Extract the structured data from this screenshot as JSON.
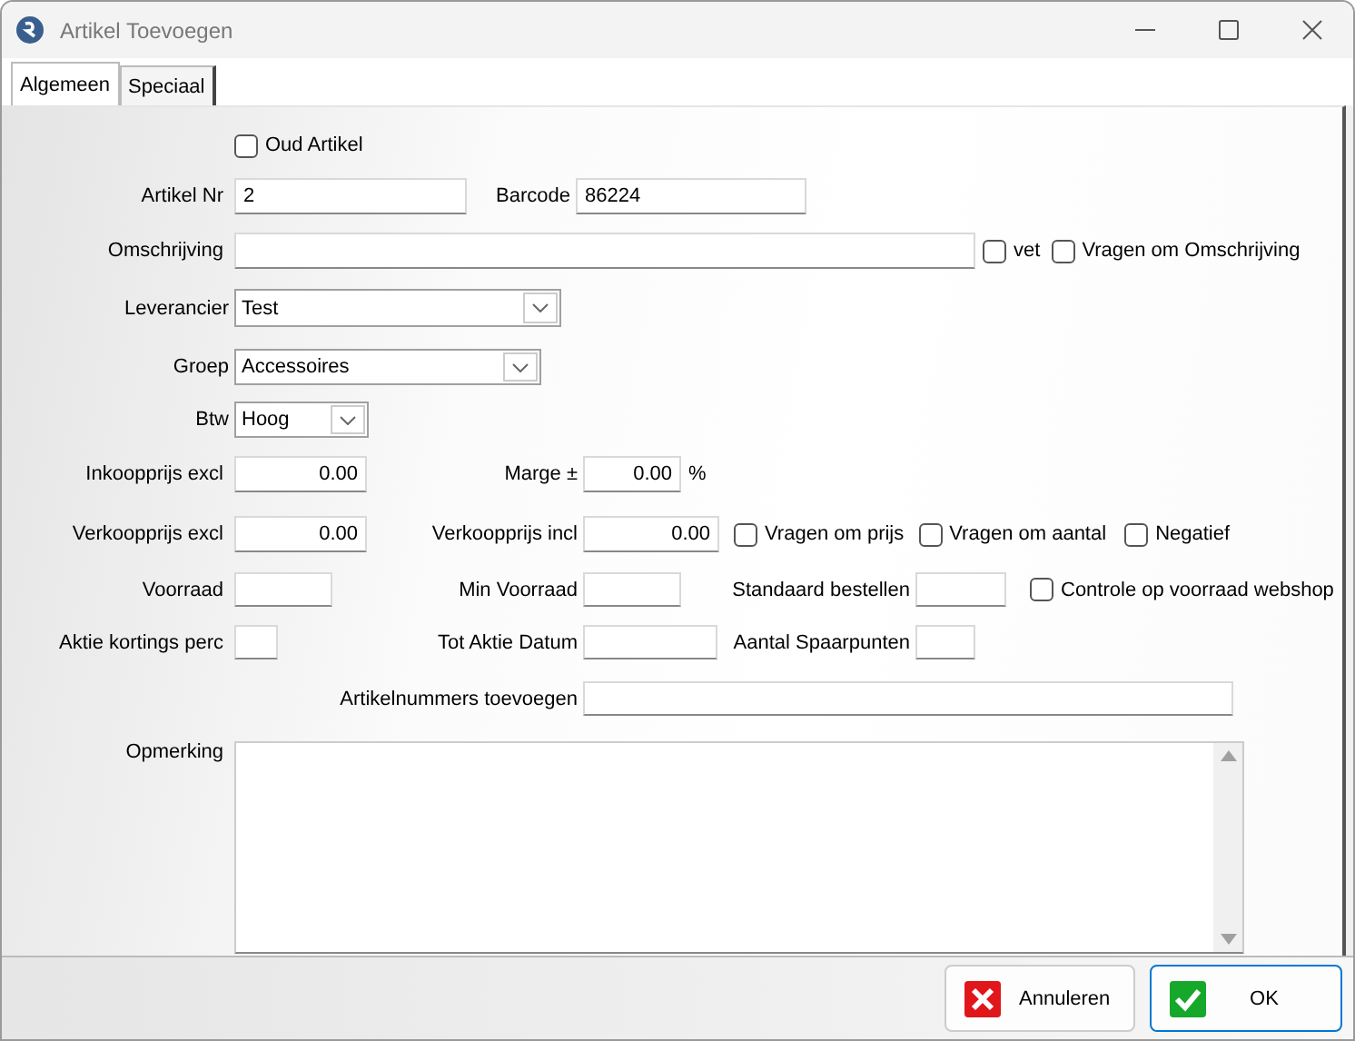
{
  "window": {
    "title": "Artikel Toevoegen"
  },
  "tabs": [
    {
      "label": "Algemeen",
      "selected": true
    },
    {
      "label": "Speciaal",
      "selected": false
    }
  ],
  "oud_artikel": {
    "label": "Oud Artikel",
    "checked": false
  },
  "artikel_nr": {
    "label": "Artikel Nr",
    "value": "2"
  },
  "barcode": {
    "label": "Barcode",
    "value": "86224"
  },
  "omschrijving": {
    "label": "Omschrijving"
  },
  "vet": {
    "label": "vet",
    "checked": false
  },
  "vragen_om_omschrijving": {
    "label": "Vragen om Omschrijving",
    "checked": false
  },
  "leverancier": {
    "label": "Leverancier",
    "value": "Test"
  },
  "groep": {
    "label": "Groep",
    "value": "Accessoires"
  },
  "btw": {
    "label": "Btw",
    "value": "Hoog"
  },
  "inkoopprijs_excl": {
    "label": "Inkoopprijs excl",
    "value": "0.00"
  },
  "marge": {
    "label": "Marge ±",
    "value": "0.00",
    "unit": "%"
  },
  "verkoopprijs_excl": {
    "label": "Verkoopprijs excl",
    "value": "0.00"
  },
  "verkoopprijs_incl": {
    "label": "Verkoopprijs incl",
    "value": "0.00"
  },
  "vragen_om_prijs": {
    "label": "Vragen om prijs",
    "checked": false
  },
  "vragen_om_aantal": {
    "label": "Vragen om aantal",
    "checked": false
  },
  "negatief": {
    "label": "Negatief",
    "checked": false
  },
  "voorraad": {
    "label": "Voorraad"
  },
  "min_voorraad": {
    "label": "Min Voorraad"
  },
  "standaard_bestellen": {
    "label": "Standaard bestellen"
  },
  "controle_voorraad_webshop": {
    "label": "Controle op voorraad webshop",
    "checked": false
  },
  "aktie_kortings_perc": {
    "label": "Aktie kortings perc"
  },
  "tot_aktie_datum": {
    "label": "Tot Aktie Datum"
  },
  "aantal_spaarpunten": {
    "label": "Aantal Spaarpunten"
  },
  "artikelnummers_toevoegen": {
    "label": "Artikelnummers toevoegen"
  },
  "opmerking": {
    "label": "Opmerking"
  },
  "buttons": [
    {
      "label": "Annuleren",
      "kind": "cancel",
      "default": false
    },
    {
      "label": "OK",
      "kind": "ok",
      "default": true
    }
  ]
}
